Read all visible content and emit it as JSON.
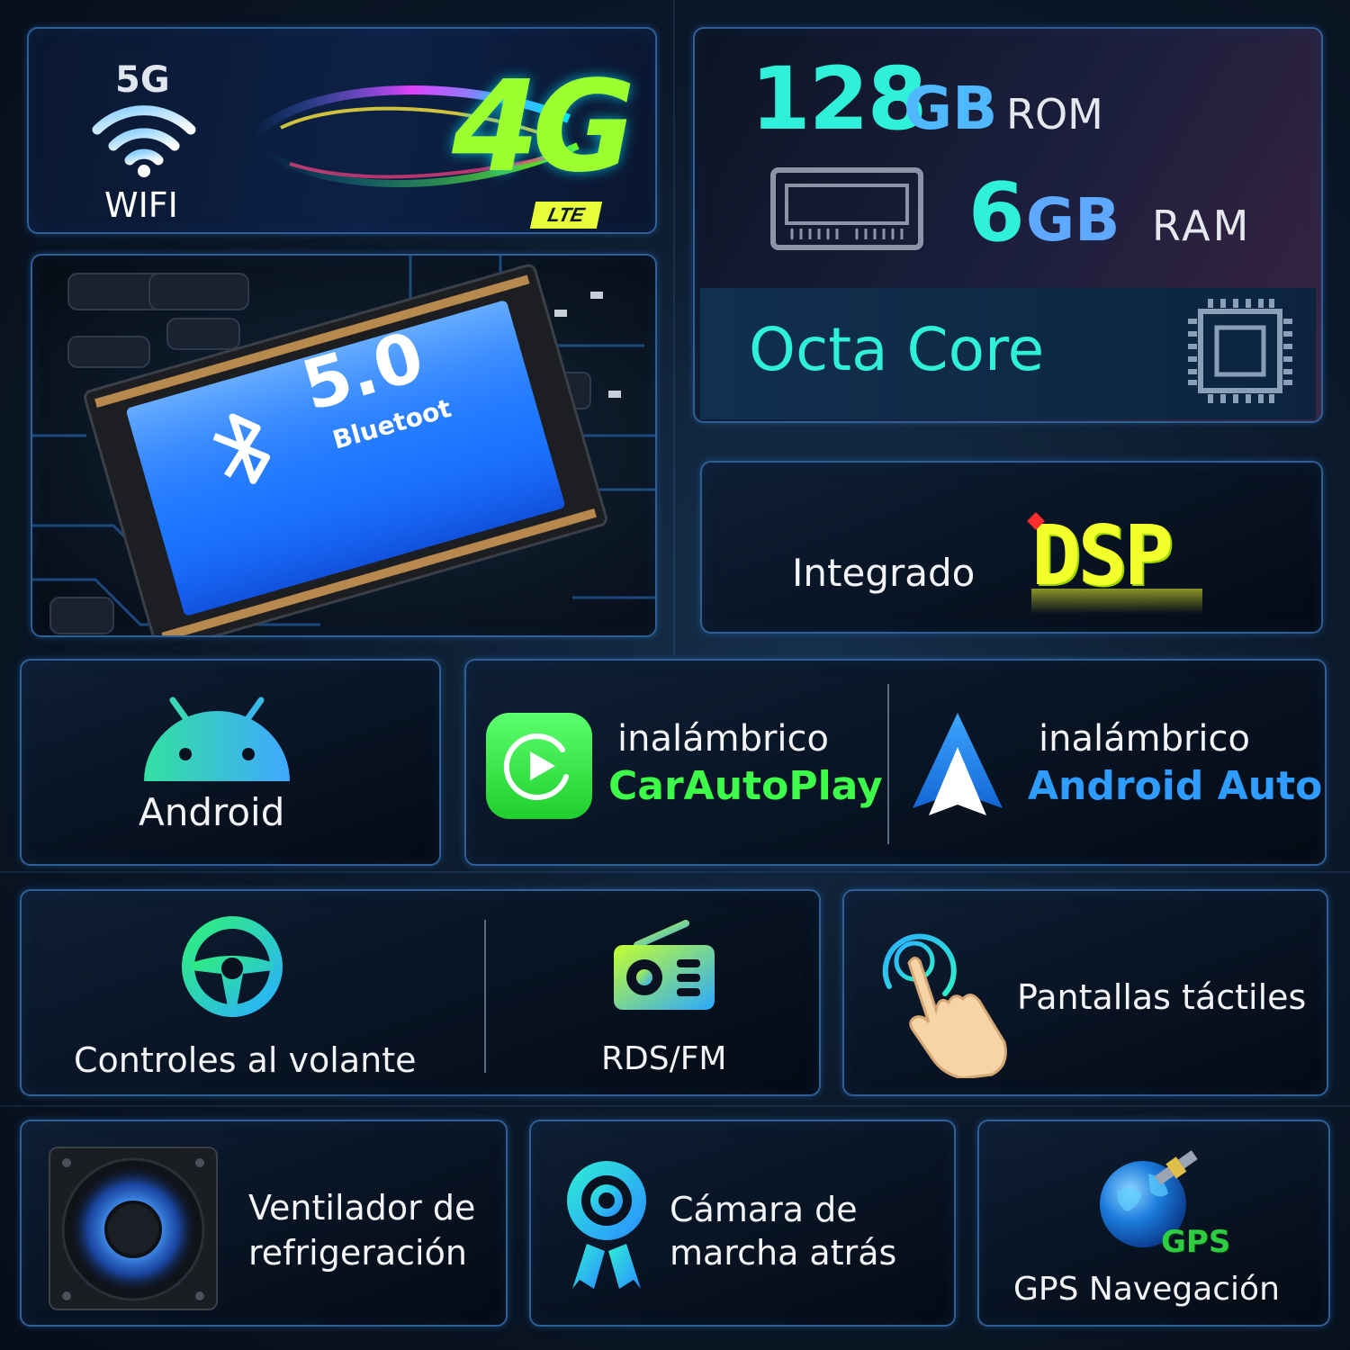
{
  "connectivity": {
    "wifi_badge": "5G",
    "wifi_label": "WIFI",
    "network_badge": "4G",
    "network_sub": "LTE"
  },
  "memory": {
    "rom_value": "128",
    "rom_unit": "GB",
    "rom_label": "ROM",
    "ram_value": "6",
    "ram_unit": "GB",
    "ram_label": "RAM"
  },
  "cpu": {
    "label": "Octa Core"
  },
  "bluetooth": {
    "version": "5.0",
    "label": "Bluetoot"
  },
  "dsp": {
    "prefix": "Integrado",
    "logo": "DSP"
  },
  "android": {
    "label": "Android"
  },
  "carplay": {
    "top": "inalámbrico",
    "name": "CarAutoPlay"
  },
  "android_auto": {
    "top": "inalámbrico",
    "name": "Android Auto"
  },
  "steering": {
    "label": "Controles al volante"
  },
  "radio": {
    "label": "RDS/FM"
  },
  "touch": {
    "label": "Pantallas táctiles"
  },
  "fan": {
    "line1": "Ventilador de",
    "line2": "refrigeración"
  },
  "camera": {
    "line1": "Cámara de",
    "line2": "marcha atrás"
  },
  "gps": {
    "badge": "GPS",
    "label": "GPS Navegación"
  }
}
